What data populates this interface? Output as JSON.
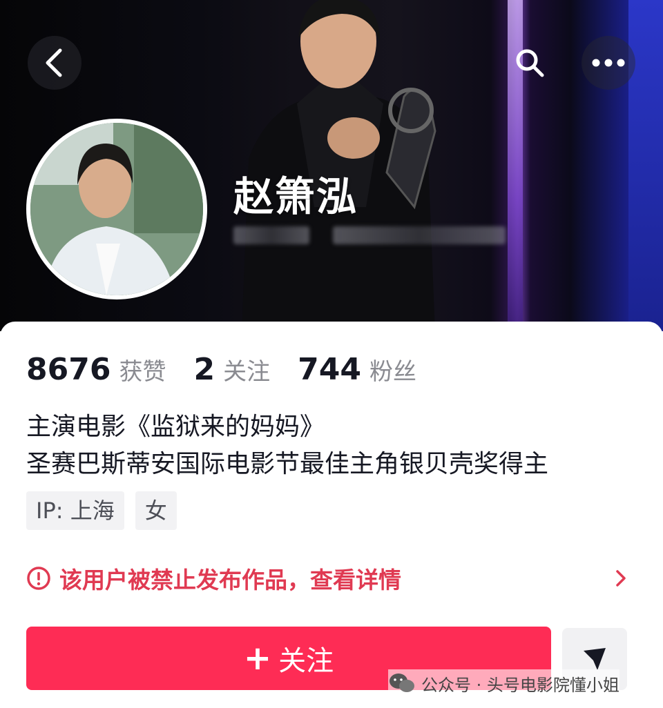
{
  "profile": {
    "name": "赵箫泓"
  },
  "stats": [
    {
      "value": "8676",
      "label": "获赞"
    },
    {
      "value": "2",
      "label": "关注"
    },
    {
      "value": "744",
      "label": "粉丝"
    }
  ],
  "bio": {
    "line1": "主演电影《监狱来的妈妈》",
    "line2": "圣赛巴斯蒂安国际电影节最佳主角银贝壳奖得主"
  },
  "tags": [
    "IP: 上海",
    "女"
  ],
  "warning": {
    "text": "该用户被禁止发布作品，查看详情"
  },
  "actions": {
    "follow_plus": "+",
    "follow_label": "关注"
  },
  "watermark": {
    "text": "公众号 · 头号电影院懂小姐"
  },
  "icons": {
    "back": "chevron-left-icon",
    "search": "search-icon",
    "more": "more-horizontal-icon",
    "warning": "alert-circle-icon",
    "arrow": "chevron-right-icon",
    "share": "send-arrow-icon",
    "watermark": "wechat-icon"
  },
  "colors": {
    "accent": "#fe2c55",
    "warning": "#e03a52"
  }
}
